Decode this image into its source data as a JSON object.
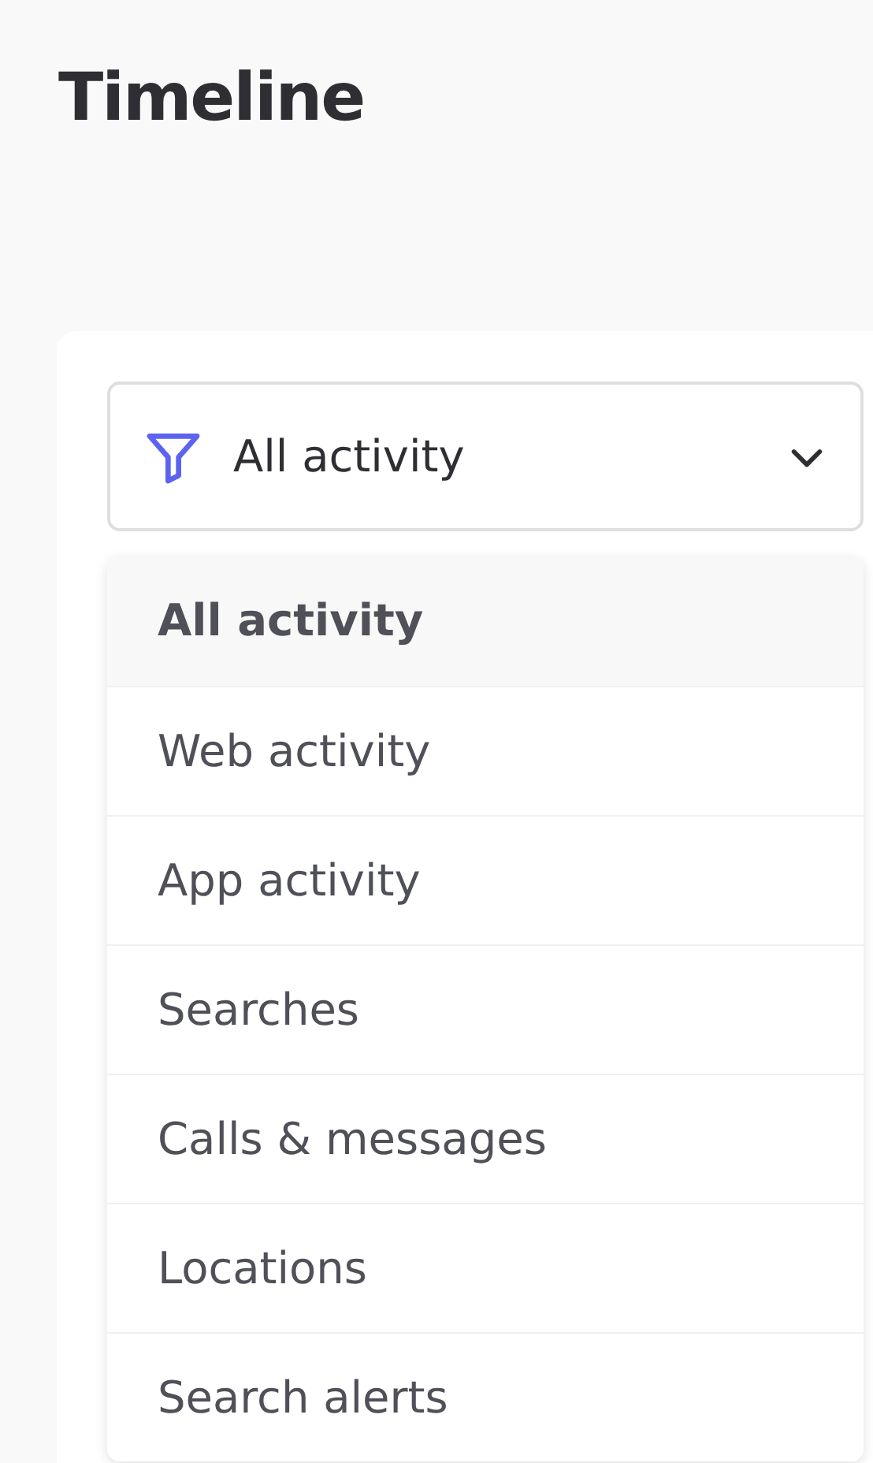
{
  "page": {
    "title": "Timeline"
  },
  "filter": {
    "value": "All activity",
    "expanded": true
  },
  "options": [
    {
      "label": "All activity",
      "selected": true
    },
    {
      "label": "Web activity",
      "selected": false
    },
    {
      "label": "App activity",
      "selected": false
    },
    {
      "label": "Searches",
      "selected": false
    },
    {
      "label": "Calls & messages",
      "selected": false
    },
    {
      "label": "Locations",
      "selected": false
    },
    {
      "label": "Search alerts",
      "selected": false
    }
  ]
}
